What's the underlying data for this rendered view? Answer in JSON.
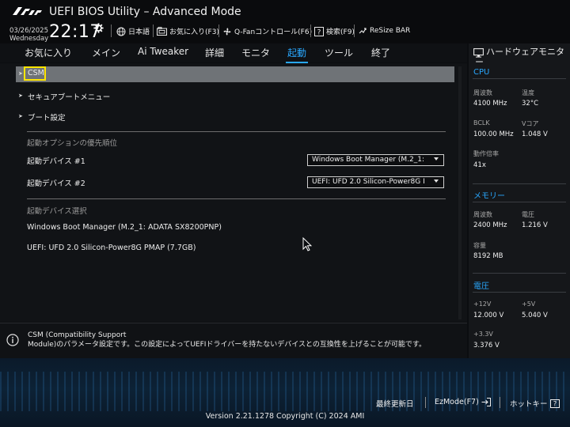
{
  "header": {
    "app_title": "UEFI BIOS Utility – Advanced Mode",
    "date": "03/26/2025",
    "weekday": "Wednesday",
    "time": "22:17",
    "tools": [
      {
        "label": "日本語",
        "icon": "globe-icon"
      },
      {
        "label": "お気に入り(F3)",
        "icon": "favorites-icon"
      },
      {
        "label": "Q-Fanコントロール(F6)",
        "icon": "fan-icon"
      },
      {
        "label": "検索(F9)",
        "icon": "search-help-icon"
      },
      {
        "label": "ReSize BAR",
        "icon": "resize-bar-icon"
      }
    ]
  },
  "nav": {
    "tabs": [
      "お気に入り",
      "メイン",
      "Ai Tweaker",
      "詳細",
      "モニタ",
      "起動",
      "ツール",
      "終了"
    ],
    "active_tab": "起動"
  },
  "main": {
    "items": [
      {
        "label": "CSM",
        "selected": true
      },
      {
        "label": "セキュアブートメニュー"
      },
      {
        "label": "ブート設定"
      }
    ],
    "boot_option_priority": {
      "heading": "起動オプションの優先順位",
      "devices": [
        {
          "label": "起動デバイス #1",
          "value": "Windows Boot Manager (M.2_1:"
        },
        {
          "label": "起動デバイス #2",
          "value": "UEFI: UFD 2.0 Silicon-Power8G I"
        }
      ]
    },
    "boot_override": {
      "heading": "起動デバイス選択",
      "options": [
        "Windows Boot Manager (M.2_1: ADATA SX8200PNP)",
        "UEFI: UFD 2.0 Silicon-Power8G PMAP (7.7GB)"
      ]
    }
  },
  "info": {
    "line1": "CSM (Compatibility Support",
    "line2": "Module)のパラメータ設定です。この設定によってUEFIドライバーを持たないデバイスとの互換性を上げることが可能です。"
  },
  "hardware_monitor": {
    "title": "ハードウェアモニター",
    "cpu": {
      "heading": "CPU",
      "frequency_label": "周波数",
      "frequency": "4100 MHz",
      "temperature_label": "温度",
      "temperature": "32°C",
      "bclk_label": "BCLK",
      "bclk": "100.00 MHz",
      "vcore_label": "Vコア",
      "vcore": "1.048 V",
      "ratio_label": "動作倍率",
      "ratio": "41x"
    },
    "memory": {
      "heading": "メモリー",
      "frequency_label": "周波数",
      "frequency": "2400 MHz",
      "voltage_label": "電圧",
      "voltage": "1.216 V",
      "capacity_label": "容量",
      "capacity": "8192 MB"
    },
    "voltage": {
      "heading": "電圧",
      "v12_label": "+12V",
      "v12": "12.000 V",
      "v5_label": "+5V",
      "v5": "5.040 V",
      "v33_label": "+3.3V",
      "v33": "3.376 V"
    }
  },
  "footer": {
    "last_modified": "最終更新日",
    "ezmode": "EzMode(F7)",
    "hotkeys": "ホットキー",
    "version": "Version 2.21.1278 Copyright (C) 2024 AMI"
  },
  "colors": {
    "accent": "#29a8ff",
    "highlight_border": "#ffe600",
    "selected_row": "#6f7377"
  }
}
